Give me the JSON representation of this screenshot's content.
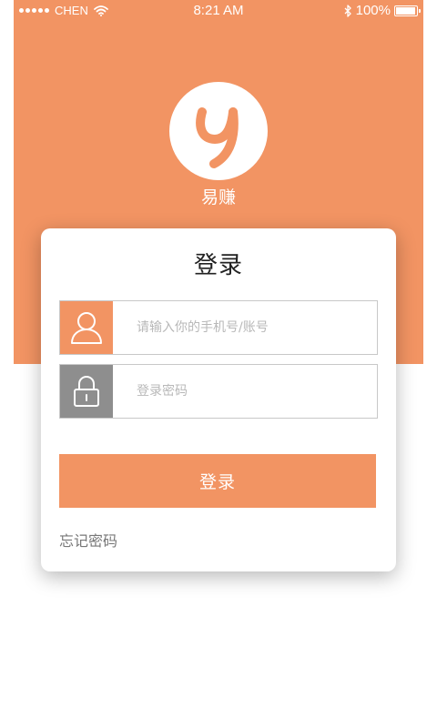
{
  "status_bar": {
    "carrier": "CHEN",
    "time": "8:21 AM",
    "battery": "100%",
    "battery_level": 1.0
  },
  "app": {
    "name": "易赚",
    "brand_color": "#F29463"
  },
  "login": {
    "title": "登录",
    "phone_placeholder": "请输入你的手机号/账号",
    "password_placeholder": "登录密码",
    "submit_label": "登录",
    "forgot_label": "忘记密码"
  },
  "icons": {
    "user": "user-icon",
    "lock": "lock-icon",
    "logo": "logo-y-icon"
  }
}
